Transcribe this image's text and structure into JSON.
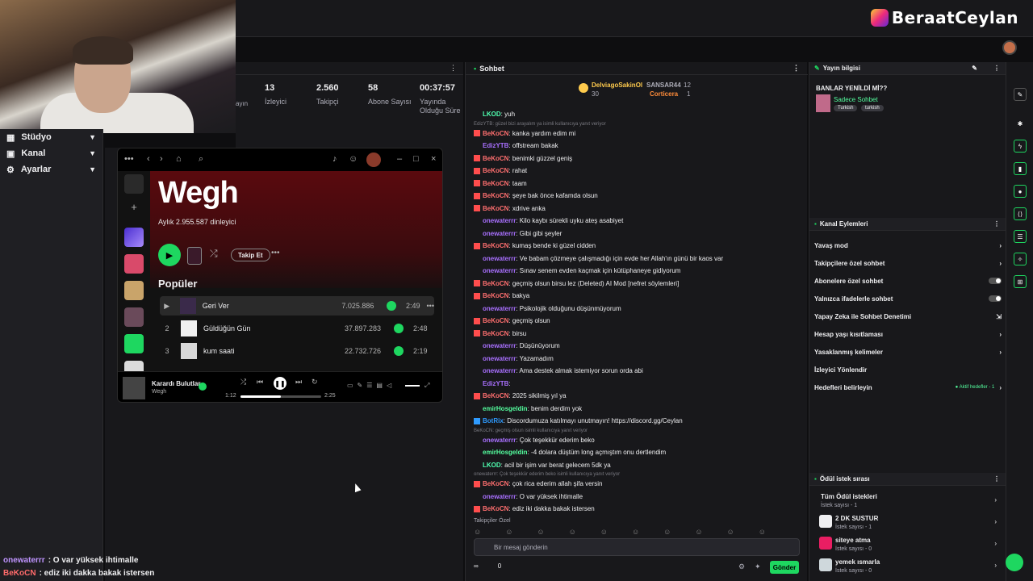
{
  "brand": "BeraatCeylan",
  "leftnav": [
    {
      "label": "Stüdyo"
    },
    {
      "label": "Kanal"
    },
    {
      "label": "Ayarlar"
    }
  ],
  "stats": [
    {
      "num": "13",
      "label": "İzleyici"
    },
    {
      "num": "2.560",
      "label": "Takipçi"
    },
    {
      "num": "58",
      "label": "Abone Sayısı"
    },
    {
      "num": "00:37:57",
      "label": "Yayında Olduğu Süre"
    }
  ],
  "stats_truncated": "ayın",
  "overlay": [
    {
      "user": "onewaterrr",
      "text": ": O var yüksek ihtimalle"
    },
    {
      "user": "BeKoCN",
      "text": ": ediz iki dakka bakak istersen"
    }
  ],
  "spotify": {
    "artist": "Wegh",
    "listeners": "Aylık 2.955.587 dinleyici",
    "follow": "Takip Et",
    "popular": "Popüler",
    "tracks": [
      {
        "idx": "▶",
        "title": "Geri Ver",
        "plays": "7.025.886",
        "dur": "2:49"
      },
      {
        "idx": "2",
        "title": "Güldüğün Gün",
        "plays": "37.897.283",
        "dur": "2:48"
      },
      {
        "idx": "3",
        "title": "kum saati",
        "plays": "22.732.726",
        "dur": "2:19"
      }
    ],
    "now_playing": {
      "title": "Karardı Bulutlar",
      "artist": "Wegh",
      "elapsed": "1:12",
      "total": "2:25",
      "progress": 0.5
    }
  },
  "chat": {
    "title": "Sohbet",
    "top_users": [
      {
        "name": "DelviagoSakinOl",
        "value": "30"
      },
      {
        "name": "SANSAR44",
        "value": "12"
      },
      {
        "name": "Corticera",
        "value": "1"
      }
    ],
    "messages": [
      {
        "user": "LKOD",
        "color": "c-lk",
        "text": ": yuh"
      },
      {
        "small": true,
        "text": "EdizYTB: güzel bizi arayalım ya isimli kullanıcıya yanıt veriyor"
      },
      {
        "user": "BeKoCN",
        "color": "c-red",
        "text": ": kanka yardım edim mi"
      },
      {
        "user": "EdizYTB",
        "color": "c-pur",
        "text": ": offstream bakak"
      },
      {
        "user": "BeKoCN",
        "color": "c-red",
        "text": ": benimki güzzel geniş"
      },
      {
        "user": "BeKoCN",
        "color": "c-red",
        "text": ": rahat"
      },
      {
        "user": "BeKoCN",
        "color": "c-red",
        "text": ": taam"
      },
      {
        "user": "BeKoCN",
        "color": "c-red",
        "text": ": şeye bak önce kafamda olsun"
      },
      {
        "user": "BeKoCN",
        "color": "c-red",
        "text": ": xdrive anka"
      },
      {
        "user": "onewaterrr",
        "color": "c-pur",
        "text": ": Kilo kaybı sürekli uyku ateş asabiyet"
      },
      {
        "user": "onewaterrr",
        "color": "c-pur",
        "text": ": Gibi gibi şeyler"
      },
      {
        "user": "BeKoCN",
        "color": "c-red",
        "text": ": kumaş bende ki güzel cidden"
      },
      {
        "user": "onewaterrr",
        "color": "c-pur",
        "text": ": Ve babam çözmeye çalışmadığı için evde her Allah'ın günü bir kaos var"
      },
      {
        "user": "onewaterrr",
        "color": "c-pur",
        "text": ": Sınav senem evden kaçmak için kütüphaneye gidiyorum"
      },
      {
        "user": "BeKoCN",
        "color": "c-red",
        "text": ": geçmiş olsun birsu lez (Deleted) AI Mod [nefret söylemleri]"
      },
      {
        "user": "BeKoCN",
        "color": "c-red",
        "text": ": bakya"
      },
      {
        "user": "onewaterrr",
        "color": "c-pur",
        "text": ": Psikolojik olduğunu düşünmüyorum"
      },
      {
        "user": "BeKoCN",
        "color": "c-red",
        "text": ": geçmiş olsun"
      },
      {
        "user": "BeKoCN",
        "color": "c-red",
        "text": ": birsu"
      },
      {
        "user": "onewaterrr",
        "color": "c-pur",
        "text": ": Düşünüyorum"
      },
      {
        "user": "onewaterrr",
        "color": "c-pur",
        "text": ": Yazamadım"
      },
      {
        "user": "onewaterrr",
        "color": "c-pur",
        "text": ": Ama destek almak istemiyor sorun orda abi"
      },
      {
        "user": "EdizYTB",
        "color": "c-pur",
        "text": ":"
      },
      {
        "user": "BeKoCN",
        "color": "c-red",
        "text": ": 2025 sikilmiş yıl ya"
      },
      {
        "user": "emirHosgeldin",
        "color": "c-grn",
        "text": ": benim derdim yok"
      },
      {
        "user": "BotRix",
        "color": "c-blu",
        "text": ": Discordumuza katılmayı unutmayın! https://discord.gg/Ceylan"
      },
      {
        "small": true,
        "text": "BeKoCN: geçmiş olsun isimli kullanıcıya yanıt veriyor"
      },
      {
        "user": "onewaterrr",
        "color": "c-pur",
        "text": ": Çok teşekkür ederim beko"
      },
      {
        "user": "emirHosgeldin",
        "color": "c-grn",
        "text": ": -4 dolara düştüm long açmıştım onu dertlendim"
      },
      {
        "user": "LKOD",
        "color": "c-lk",
        "text": ": acil bir işim var berat gelecem 5dk ya"
      },
      {
        "small": true,
        "text": "onewaterrr: Çok teşekkür ederim beko isimli kullanıcıya yanıt veriyor"
      },
      {
        "user": "BeKoCN",
        "color": "c-red",
        "text": ": çok rica ederim allah şifa versin"
      },
      {
        "user": "onewaterrr",
        "color": "c-pur",
        "text": ": O var yüksek ihtimalle"
      },
      {
        "user": "BeKoCN",
        "color": "c-red",
        "text": ": ediz iki dakka bakak istersen"
      }
    ],
    "followers_only": "Takipçiler Özel",
    "input_placeholder": "Bir mesaj gönderin",
    "send": "Gönder",
    "count_left": "∞",
    "count_right": "0"
  },
  "stream_info": {
    "title": "Yayın bilgisi",
    "stream_title": "BANLAR YENİLDİ Mİ??",
    "category": "Sadece Sohbet",
    "tags": [
      "Turkish",
      "turkish"
    ]
  },
  "channel_actions": {
    "title": "Kanal Eylemleri",
    "items": [
      {
        "label": "Yavaş mod",
        "kind": "arrow"
      },
      {
        "label": "Takipçilere özel sohbet",
        "kind": "arrow"
      },
      {
        "label": "Abonelere özel sohbet",
        "kind": "toggle"
      },
      {
        "label": "Yalnızca ifadelerle sohbet",
        "kind": "toggle"
      },
      {
        "label": "Yapay Zeka ile Sohbet Denetimi",
        "kind": "ext"
      },
      {
        "label": "Hesap yaşı kısıtlaması",
        "kind": "arrow"
      },
      {
        "label": "Yasaklanmış kelimeler",
        "kind": "arrow"
      },
      {
        "label": "İzleyici Yönlendir",
        "kind": "none"
      },
      {
        "label": "Hedefleri belirleyin",
        "kind": "goal",
        "extra": "● Aktif hedefler - 1"
      }
    ]
  },
  "rewards": {
    "title": "Ödül istek sırası",
    "items": [
      {
        "title": "Tüm Ödül istekleri",
        "sub": "İstek sayısı - 1",
        "color": ""
      },
      {
        "title": "2 DK SUSTUR",
        "sub": "İstek sayısı - 1",
        "color": "#efeff1"
      },
      {
        "title": "siteye atma",
        "sub": "İstek sayısı - 0",
        "color": "#e91e63"
      },
      {
        "title": "yemek ısmarla",
        "sub": "İstek sayısı - 0",
        "color": "#cfd8dc"
      }
    ]
  }
}
